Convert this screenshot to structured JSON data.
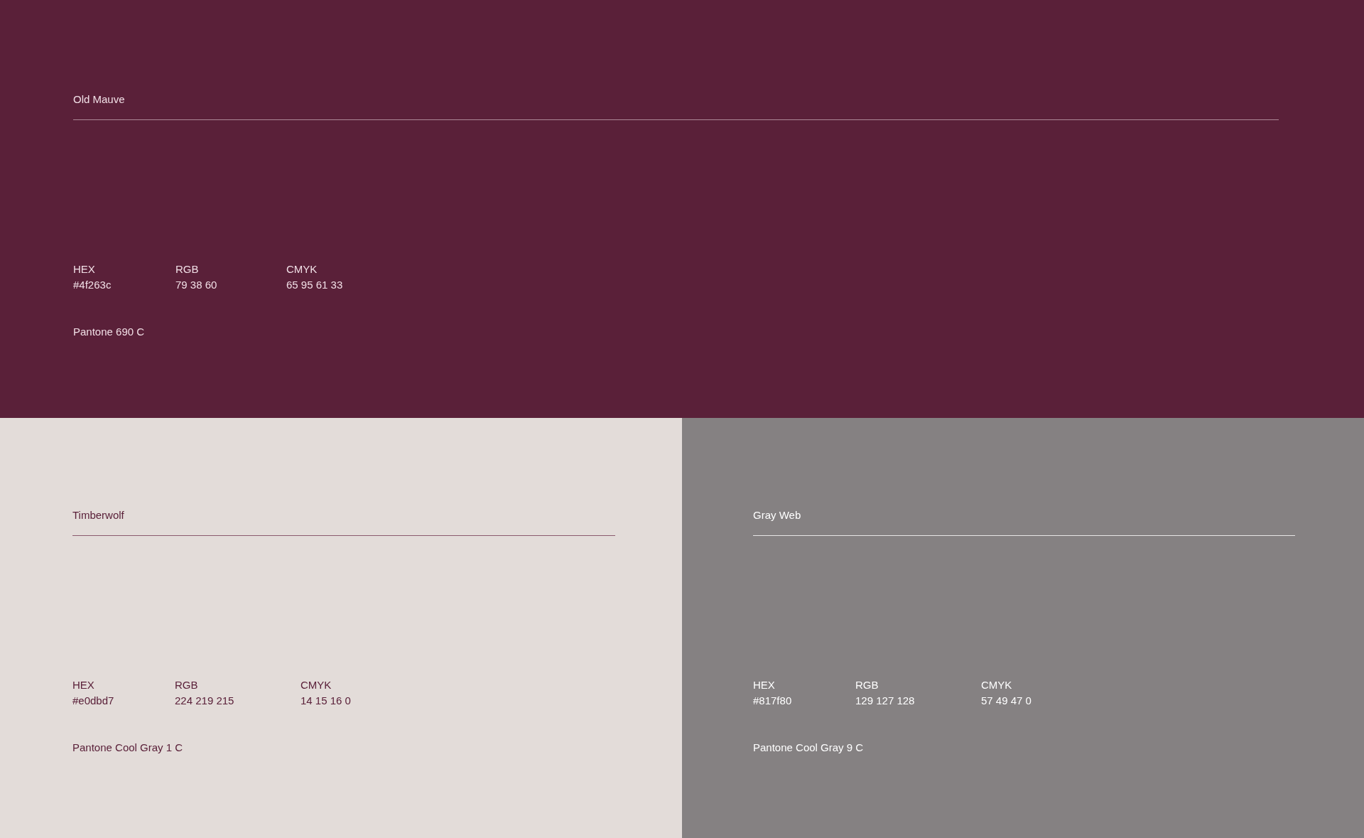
{
  "swatches": [
    {
      "name": "Old Mauve",
      "color": "#5a2039",
      "specs": [
        {
          "label": "HEX",
          "value": "#4f263c"
        },
        {
          "label": "RGB",
          "value": "79 38 60"
        },
        {
          "label": "CMYK",
          "value": "65 95 61 33"
        }
      ],
      "pantone": "Pantone 690 C"
    },
    {
      "name": "Timberwolf",
      "color": "#e3dcd9",
      "specs": [
        {
          "label": "HEX",
          "value": "#e0dbd7"
        },
        {
          "label": "RGB",
          "value": "224 219 215"
        },
        {
          "label": "CMYK",
          "value": "14 15 16 0"
        }
      ],
      "pantone": "Pantone Cool Gray 1 C"
    },
    {
      "name": "Gray Web",
      "color": "#858182",
      "specs": [
        {
          "label": "HEX",
          "value": "#817f80"
        },
        {
          "label": "RGB",
          "value": "129 127 128"
        },
        {
          "label": "CMYK",
          "value": "57 49 47 0"
        }
      ],
      "pantone": "Pantone Cool Gray 9 C"
    }
  ]
}
